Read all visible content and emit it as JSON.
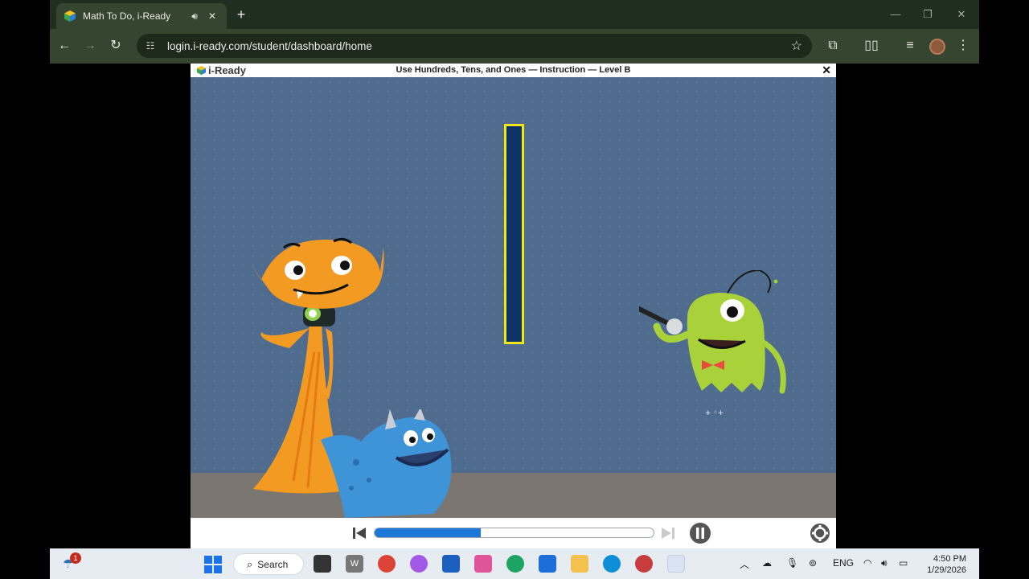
{
  "browser": {
    "tab_title": "Math To Do, i-Ready",
    "url": "login.i-ready.com/student/dashboard/home"
  },
  "lesson": {
    "logo_text": "i-Ready",
    "title": "Use Hundreds, Tens, and Ones — Instruction — Level B",
    "close_glyph": "✕",
    "progress_fraction": 0.38
  },
  "taskbar": {
    "search_label": "Search",
    "notification_count": "1",
    "language": "ENG",
    "time": "4:50 PM",
    "date": "1/29/2026"
  },
  "colors": {
    "stage_bg": "#4f6c8e",
    "rod_fill": "#0d3266",
    "rod_border": "#f3e516",
    "progress_fill": "#1c78d6"
  }
}
